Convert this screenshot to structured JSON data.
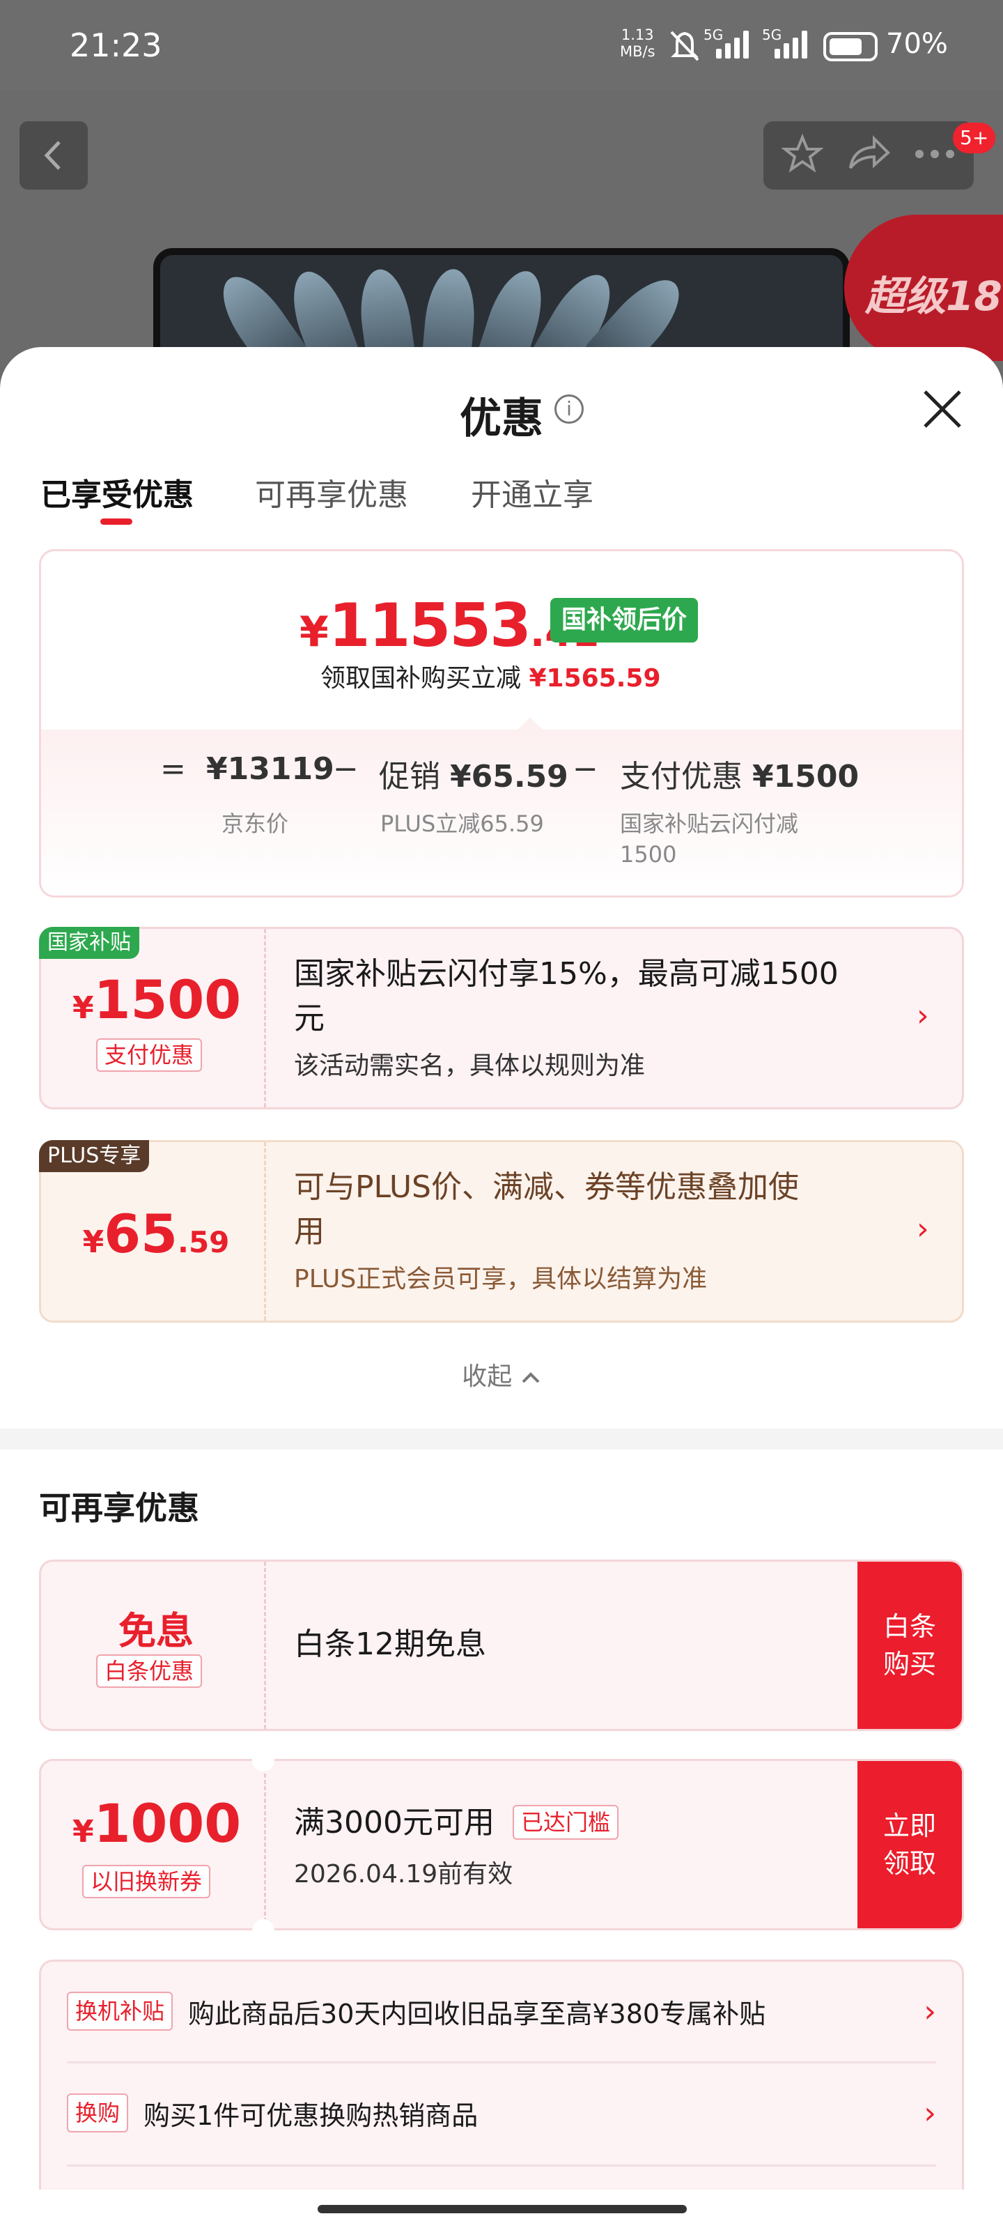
{
  "status_bar": {
    "time": "21:23",
    "net_speed_value": "1.13",
    "net_speed_unit": "MB/s",
    "sim1": "5G",
    "sim2": "5G",
    "battery": "70%"
  },
  "header": {
    "badge": "5+",
    "super_tag": "超级18"
  },
  "sheet": {
    "title": "优惠",
    "tabs": [
      "已享受优惠",
      "可再享优惠",
      "开通立享"
    ]
  },
  "summary": {
    "currency": "¥",
    "price_int": "11553",
    "price_dec": ".41",
    "price_tag": "国补领后价",
    "lead_text": "领取国补购买立减",
    "lead_amount": "¥1565.59",
    "eq": "=",
    "minus": "−",
    "jd_price": "¥13119",
    "jd_label": "京东价",
    "promo_label": "促销",
    "promo_amount": "¥65.59",
    "promo_sub": "PLUS立减65.59",
    "pay_label": "支付优惠",
    "pay_amount": "¥1500",
    "pay_sub_line1": "国家补贴云闪付减",
    "pay_sub_line2": "1500"
  },
  "offers": [
    {
      "corner": "国家补贴",
      "currency": "¥",
      "amount": "1500",
      "pill": "支付优惠",
      "title_line1": "国家补贴云闪付享15%，最高可减1500",
      "title_line2": "元",
      "desc": "该活动需实名，具体以规则为准"
    },
    {
      "corner": "PLUS专享",
      "currency": "¥",
      "amount": "65",
      "amount_dec": ".59",
      "title_line1": "可与PLUS价、满减、券等优惠叠加使",
      "title_line2": "用",
      "desc": "PLUS正式会员可享，具体以结算为准"
    }
  ],
  "collapse_label": "收起",
  "section2_title": "可再享优惠",
  "more_offers": [
    {
      "big": "免息",
      "pill": "白条优惠",
      "title": "白条12期免息",
      "button_line1": "白条",
      "button_line2": "购买"
    },
    {
      "currency": "¥",
      "amount": "1000",
      "pill": "以旧换新券",
      "title": "满3000元可用",
      "tag": "已达门槛",
      "desc": "2026.04.19前有效",
      "button_line1": "立即",
      "button_line2": "领取"
    }
  ],
  "list_items": [
    {
      "tag": "换机补贴",
      "text": "购此商品后30天内回收旧品享至高¥380专属补贴"
    },
    {
      "tag": "换购",
      "text": "购买1件可优惠换购热销商品"
    }
  ]
}
